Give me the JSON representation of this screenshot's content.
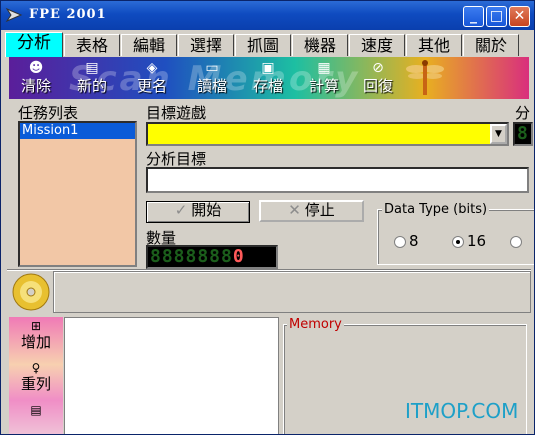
{
  "window": {
    "title": "FPE 2001",
    "min": "_",
    "max": "□",
    "close": "✕"
  },
  "tabs": [
    "分析",
    "表格",
    "編輯",
    "選擇",
    "抓圖",
    "機器",
    "速度",
    "其他",
    "關於"
  ],
  "toolbar": {
    "watermark": "Scan Memory",
    "items": [
      {
        "label": "清除",
        "icon": "person-clear-icon"
      },
      {
        "label": "新的",
        "icon": "new-file-icon"
      },
      {
        "label": "更名",
        "icon": "rename-icon"
      },
      {
        "label": "讀檔",
        "icon": "open-folder-icon"
      },
      {
        "label": "存檔",
        "icon": "save-disk-icon"
      },
      {
        "label": "計算",
        "icon": "calculator-icon"
      },
      {
        "label": "回復",
        "icon": "restore-icon"
      }
    ]
  },
  "labels": {
    "task_list": "任務列表",
    "target_game": "目標遊戲",
    "analysis_target": "分析目標",
    "count": "數量",
    "right_cut": "分"
  },
  "task_list": [
    "Mission1"
  ],
  "buttons": {
    "start": "開始",
    "stop": "停止"
  },
  "counter": {
    "digits": "8888888",
    "last": "0"
  },
  "side_lcd": "8",
  "data_type": {
    "title": "Data Type (bits)",
    "options": [
      {
        "label": "8",
        "selected": false
      },
      {
        "label": "16",
        "selected": true
      }
    ]
  },
  "sidebar": [
    {
      "label": "增加",
      "icon": "add-icon"
    },
    {
      "label": "重列",
      "icon": "relist-icon"
    }
  ],
  "memory_group": "Memory",
  "brand": "ITMOP.COM",
  "colors": {
    "titlebar": "#0f4bc0",
    "active_tab": "#00ffff",
    "combo": "#ffff00",
    "listbox": "#f2c7a6"
  }
}
